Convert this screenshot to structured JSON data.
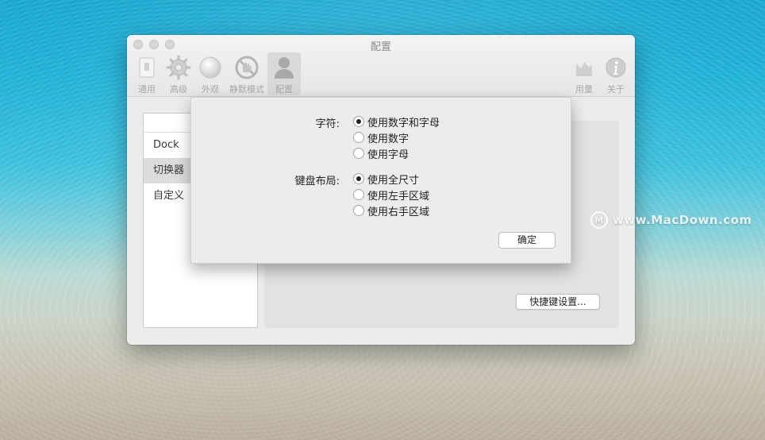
{
  "window": {
    "title": "配置"
  },
  "toolbar": {
    "items": [
      {
        "label": "通用",
        "icon": "general-icon"
      },
      {
        "label": "高级",
        "icon": "gear-icon"
      },
      {
        "label": "外观",
        "icon": "appearance-icon"
      },
      {
        "label": "静默模式",
        "icon": "silent-mode-icon"
      },
      {
        "label": "配置",
        "icon": "user-icon",
        "active": true
      },
      {
        "label": "用量",
        "icon": "usage-chart-icon"
      },
      {
        "label": "关于",
        "icon": "info-icon"
      }
    ]
  },
  "sidebar": {
    "items": [
      {
        "label": "Dock"
      },
      {
        "label": "切换器",
        "selected": true
      },
      {
        "label": "自定义"
      }
    ]
  },
  "main": {
    "shortcut_button": "快捷键设置..."
  },
  "sheet": {
    "characters_label": "字符:",
    "characters_options": [
      "使用数字和字母",
      "使用数字",
      "使用字母"
    ],
    "characters_selected": 0,
    "layout_label": "键盘布局:",
    "layout_options": [
      "使用全尺寸",
      "使用左手区域",
      "使用右手区域"
    ],
    "layout_selected": 0,
    "ok_button": "确定"
  },
  "watermark": {
    "text": "www.MacDown.com"
  },
  "colors": {
    "window_bg": "#ececec",
    "sheet_bg": "#ececec",
    "selected_row": "#dcdcdc"
  }
}
